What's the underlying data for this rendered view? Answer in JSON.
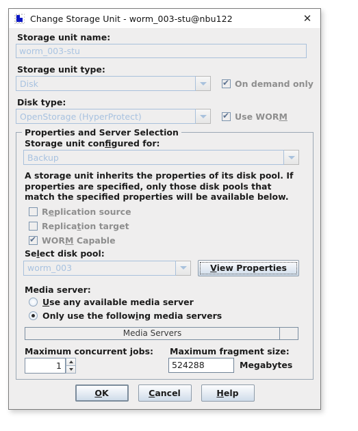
{
  "window": {
    "title": "Change Storage Unit - worm_003-stu@nbu122",
    "icon": "storage-unit-icon",
    "close_label": "✕"
  },
  "form": {
    "storage_unit_name_label": "Storage unit name:",
    "storage_unit_name_value": "worm_003-stu",
    "storage_unit_type_label": "Storage unit type:",
    "storage_unit_type_value": "Disk",
    "on_demand_only_label": "On demand only",
    "on_demand_only_checked": true,
    "disk_type_label": "Disk type:",
    "disk_type_value": "OpenStorage (HyperProtect)",
    "use_worm_label_pre": "Use WOR",
    "use_worm_label_mn": "M",
    "use_worm_label_post": "",
    "use_worm_checked": true
  },
  "properties_group": {
    "title": "Properties and Server Selection",
    "configured_for_label_pre": "Storage unit con",
    "configured_for_label_mn": "fi",
    "configured_for_label_post": "gured for:",
    "configured_for_value": "Backup",
    "description": "A storage unit inherits the properties of its disk pool. If properties are specified, only those disk pools that match the specified properties will be available below.",
    "checkboxes": [
      {
        "label_pre": "R",
        "label_mn": "e",
        "label_post": "plication source",
        "checked": false
      },
      {
        "label_pre": "Replica",
        "label_mn": "t",
        "label_post": "ion target",
        "checked": false
      },
      {
        "label_pre": "WOR",
        "label_mn": "M",
        "label_post": " Capable",
        "checked": true
      }
    ],
    "select_disk_pool_label_pre": "Se",
    "select_disk_pool_label_mn": "l",
    "select_disk_pool_label_post": "ect disk pool:",
    "select_disk_pool_value": "worm_003",
    "view_properties_pre": "",
    "view_properties_mn": "V",
    "view_properties_post": "iew Properties",
    "media_server_label": "Media server:",
    "radios": [
      {
        "label_pre": "",
        "label_mn": "U",
        "label_post": "se any available media server",
        "selected": false
      },
      {
        "label_pre": "Only use the follow",
        "label_mn": "i",
        "label_post": "ng media servers",
        "selected": true
      }
    ],
    "media_servers_column": "Media Servers",
    "max_concurrent_jobs_label": "Maximum concurrent jobs:",
    "max_concurrent_jobs_value": "1",
    "max_fragment_size_label": "Maximum fragment size:",
    "max_fragment_size_value": "524288",
    "megabytes_label": "Megabytes"
  },
  "footer": {
    "ok_pre": "",
    "ok_mn": "O",
    "ok_post": "K",
    "cancel_pre": "",
    "cancel_mn": "C",
    "cancel_post": "ancel",
    "help_pre": "",
    "help_mn": "H",
    "help_post": "elp"
  },
  "colors": {
    "dialog_bg": "#efeeee",
    "disabled_text": "#a8c2e0",
    "label_text": "#1b1b1b",
    "disabled_label": "#8e8e8e",
    "field_border": "#a8c0db",
    "button_grad_top": "#fdfdfe",
    "button_grad_bottom": "#cfdcea"
  }
}
